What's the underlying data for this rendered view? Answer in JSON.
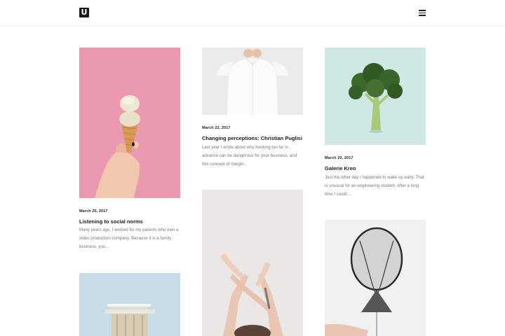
{
  "header": {
    "logo_letter": "U",
    "menu_icon": "hamburger-menu-icon"
  },
  "posts": [
    {
      "date": "March 25, 2017",
      "title": "Listening to social norms",
      "excerpt": "Many years ago, I worked for my parents who own a video production company. Because it is a family business, you...",
      "image": "ice-cream-cone-on-pink",
      "bg": "#ea99b1"
    },
    {
      "date": "March 22, 2017",
      "title": "Changing perceptions: Christian Puglisi",
      "excerpt": "Last year I wrote about why booking too far in advance can be dangerous for your business, and this concept of margin...",
      "image": "white-shirt",
      "bg": "#eceaeb"
    },
    {
      "date": "March 20, 2017",
      "title": "Galerie Kreo",
      "excerpt": "Just the other day I happened to wake up early. That is unusual for an engineering student. After a long time I could...",
      "image": "broccoli-on-mint",
      "bg": "#cfe8e6"
    },
    {
      "image": "wooden-stool-with-books",
      "bg": "#c9dbe6"
    },
    {
      "image": "raised-crossed-arms",
      "bg": "#ebe7e7"
    },
    {
      "image": "black-tulle-balloon",
      "bg": "#f1f1f1"
    }
  ]
}
